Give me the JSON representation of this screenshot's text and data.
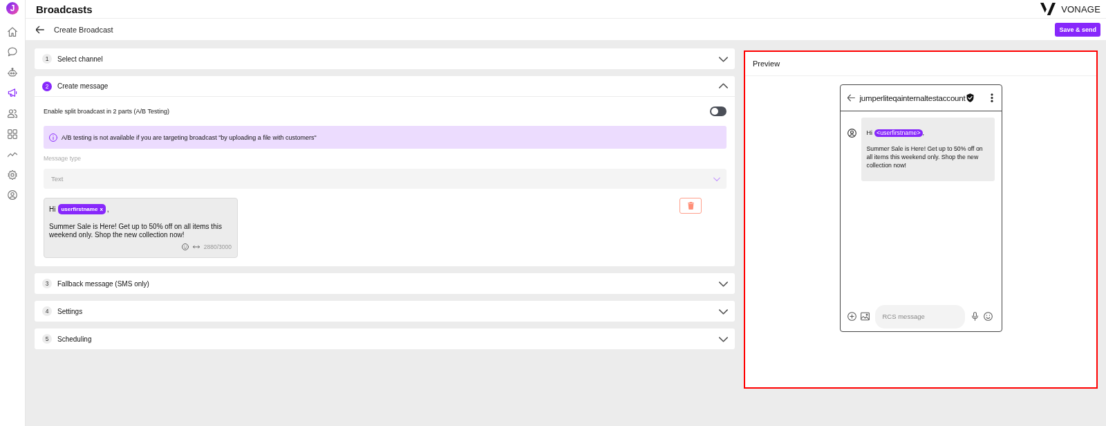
{
  "app": {
    "logo_letter": "J"
  },
  "sidebar": {
    "items": [
      {
        "selected": false
      },
      {
        "selected": false
      },
      {
        "selected": false
      },
      {
        "selected": true
      },
      {
        "selected": false
      },
      {
        "selected": false
      },
      {
        "selected": false
      },
      {
        "selected": false
      },
      {
        "selected": false
      }
    ]
  },
  "header": {
    "title": "Broadcasts",
    "brand": "VONAGE"
  },
  "toolbar": {
    "title": "Create Broadcast",
    "button": "Save & send"
  },
  "steps": [
    {
      "number": "1",
      "title": "Select channel",
      "expanded": false
    },
    {
      "number": "2",
      "title": "Create message",
      "expanded": true,
      "body": {
        "ab_toggle": {
          "label": "Enable split broadcast in 2 parts (A/B Testing)",
          "on": false
        },
        "notice": "A/B testing is not available if you are targeting broadcast \"by uploading a file with customers\"",
        "message_type": {
          "label": "Message type",
          "value": "Text",
          "disabled": true
        },
        "message": {
          "greeting": "Hi",
          "variable": "userfirstname",
          "remove_mark": "x",
          "after_variable": ",",
          "body": "Summer Sale is Here! Get up to 50% off on all items this weekend only. Shop the new collection now!",
          "counter": "2880/3000"
        }
      }
    },
    {
      "number": "3",
      "title": "Fallback message (SMS only)",
      "expanded": false
    },
    {
      "number": "4",
      "title": "Settings",
      "expanded": false
    },
    {
      "number": "5",
      "title": "Scheduling",
      "expanded": false
    }
  ],
  "preview": {
    "title": "Preview",
    "highlighted": true,
    "phone": {
      "sender": "jumperliteqainternaltestaccount",
      "verified": true,
      "message": {
        "greeting": "Hi",
        "variable": "<userfirstname>",
        "after_variable": ",",
        "body": "Summer Sale is Here! Get up to 50% off on all items this weekend only. Shop the new collection now!"
      },
      "input_placeholder": "RCS message"
    }
  }
}
